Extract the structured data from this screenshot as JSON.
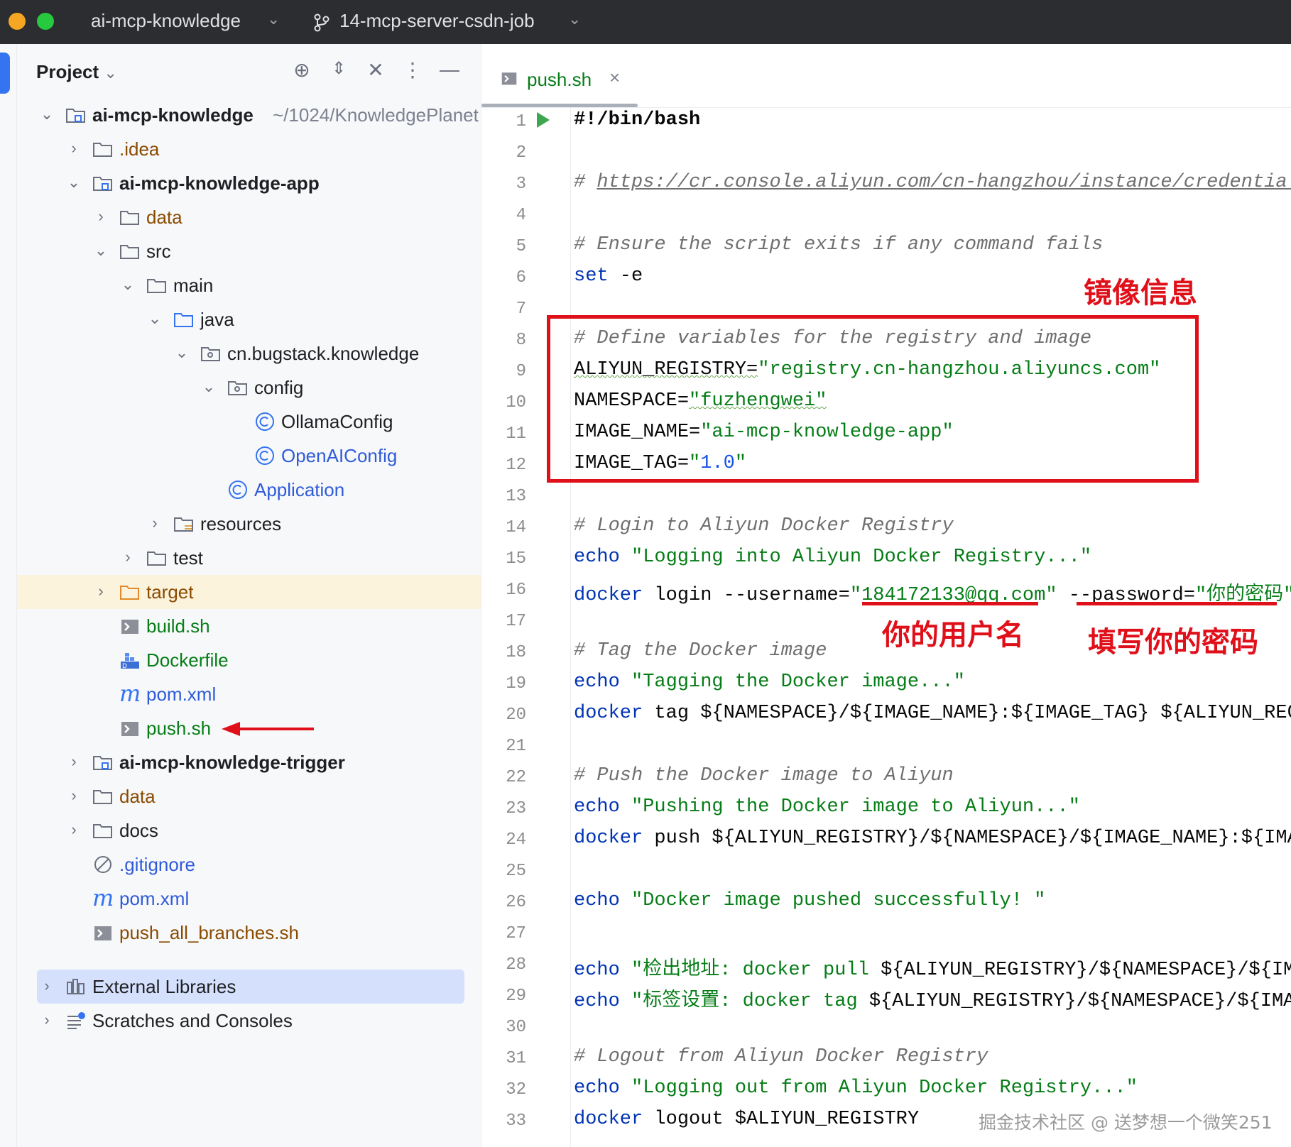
{
  "titlebar": {
    "project_name": "ai-mcp-knowledge",
    "branch": "14-mcp-server-csdn-job"
  },
  "project_panel": {
    "title": "Project",
    "root_path": "~/1024/KnowledgePlanet",
    "items": [
      {
        "label": "ai-mcp-knowledge"
      },
      {
        "label": ".idea"
      },
      {
        "label": "ai-mcp-knowledge-app"
      },
      {
        "label": "data"
      },
      {
        "label": "src"
      },
      {
        "label": "main"
      },
      {
        "label": "java"
      },
      {
        "label": "cn.bugstack.knowledge"
      },
      {
        "label": "config"
      },
      {
        "label": "OllamaConfig"
      },
      {
        "label": "OpenAIConfig"
      },
      {
        "label": "Application"
      },
      {
        "label": "resources"
      },
      {
        "label": "test"
      },
      {
        "label": "target"
      },
      {
        "label": "build.sh"
      },
      {
        "label": "Dockerfile"
      },
      {
        "label": "pom.xml"
      },
      {
        "label": "push.sh"
      },
      {
        "label": "ai-mcp-knowledge-trigger"
      },
      {
        "label": "data"
      },
      {
        "label": "docs"
      },
      {
        "label": ".gitignore"
      },
      {
        "label": "pom.xml"
      },
      {
        "label": "push_all_branches.sh"
      },
      {
        "label": "External Libraries"
      },
      {
        "label": "Scratches and Consoles"
      }
    ]
  },
  "editor": {
    "tab_label": "push.sh",
    "line_numbers": [
      "1",
      "2",
      "3",
      "4",
      "5",
      "6",
      "7",
      "8",
      "9",
      "10",
      "11",
      "12",
      "13",
      "14",
      "15",
      "16",
      "17",
      "18",
      "19",
      "20",
      "21",
      "22",
      "23",
      "24",
      "25",
      "26",
      "27",
      "28",
      "29",
      "30",
      "31",
      "32",
      "33"
    ],
    "code": {
      "l1": "#!/bin/bash",
      "l3_hash": "# ",
      "l3_url": "https://cr.console.aliyun.com/cn-hangzhou/instance/credentials",
      "l5": "# Ensure the script exits if any command fails",
      "l6_kw": "set",
      "l6_rest": " -e",
      "l8": "# Define variables for the registry and image",
      "l9_var": "ALIYUN_REGISTRY=",
      "l9_str": "\"registry.cn-hangzhou.aliyuncs.com\"",
      "l10_var": "NAMESPACE=",
      "l10_str": "\"fuzhengwei\"",
      "l11_var": "IMAGE_NAME=",
      "l11_str": "\"ai-mcp-knowledge-app\"",
      "l12_var": "IMAGE_TAG=",
      "l12_str_q1": "\"",
      "l12_num": "1.0",
      "l12_str_q2": "\"",
      "l14": "# Login to Aliyun Docker Registry",
      "l15_kw": "echo",
      "l15_str": " \"Logging into Aliyun Docker Registry...\"",
      "l16_kw": "docker",
      "l16_rest": " login --username=",
      "l16_user": "\"184172133@qq.com\"",
      "l16_mid": " --password=",
      "l16_pwd": "\"你的密码\"",
      "l18": "# Tag the Docker image",
      "l19_kw": "echo",
      "l19_str": " \"Tagging the Docker image...\"",
      "l20_kw": "docker",
      "l20_rest": " tag ${NAMESPACE}/${IMAGE_NAME}:${IMAGE_TAG} ${ALIYUN_REGISTRY}/${NAMESPACE}/${IMAGE_NAME}:${IMAGE_TAG}",
      "l22": "# Push the Docker image to Aliyun",
      "l23_kw": "echo",
      "l23_str": " \"Pushing the Docker image to Aliyun...\"",
      "l24_kw": "docker",
      "l24_rest": " push ${ALIYUN_REGISTRY}/${NAMESPACE}/${IMAGE_NAME}:${IMAGE_TAG}",
      "l26_kw": "echo",
      "l26_str": " \"Docker image pushed successfully! \"",
      "l28_kw": "echo",
      "l28_str1": " \"检出地址: docker pull ",
      "l28_rest": "${ALIYUN_REGISTRY}/${NAMESPACE}/${IMAGE_NAME}:${IMAGE_TAG}\"",
      "l29_kw": "echo",
      "l29_str1": " \"标签设置: docker tag ",
      "l29_rest": "${ALIYUN_REGISTRY}/${NAMESPACE}/${IMAGE_NAME}:${IMAGE_TAG}\"",
      "l31": "# Logout from Aliyun Docker Registry",
      "l32_kw": "echo",
      "l32_str": " \"Logging out from Aliyun Docker Registry...\"",
      "l33_kw": "docker",
      "l33_rest": " logout $ALIYUN_REGISTRY"
    }
  },
  "annotations": {
    "image_info": "镜像信息",
    "your_username": "你的用户名",
    "fill_password": "填写你的密码"
  },
  "watermark": "掘金技术社区 @ 送梦想一个微笑251",
  "colors": {
    "annotation_red": "#e0101a",
    "string_green": "#067d17",
    "keyword_blue": "#0033b3",
    "comment_gray": "#6f6f6f"
  }
}
